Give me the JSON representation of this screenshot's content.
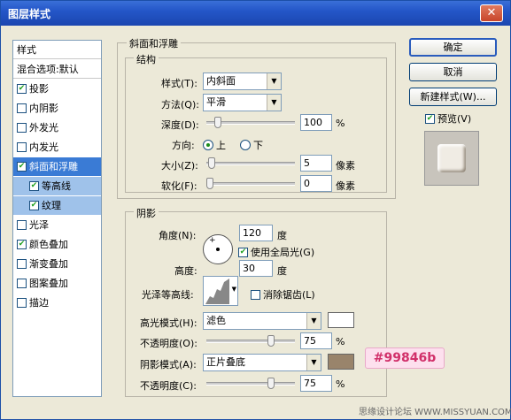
{
  "window": {
    "title": "图层样式",
    "close": "✕"
  },
  "left_panel": {
    "header": "样式",
    "blend_options": "混合选项:默认",
    "items": [
      {
        "label": "投影",
        "checked": true
      },
      {
        "label": "内阴影",
        "checked": false
      },
      {
        "label": "外发光",
        "checked": false
      },
      {
        "label": "内发光",
        "checked": false
      },
      {
        "label": "斜面和浮雕",
        "checked": true
      },
      {
        "label": "等高线",
        "checked": true
      },
      {
        "label": "纹理",
        "checked": true
      },
      {
        "label": "光泽",
        "checked": false
      },
      {
        "label": "颜色叠加",
        "checked": true
      },
      {
        "label": "渐变叠加",
        "checked": false
      },
      {
        "label": "图案叠加",
        "checked": false
      },
      {
        "label": "描边",
        "checked": false
      }
    ]
  },
  "bevel": {
    "section_title": "斜面和浮雕",
    "structure_title": "结构",
    "style_label": "样式(T):",
    "style_value": "内斜面",
    "method_label": "方法(Q):",
    "method_value": "平滑",
    "depth_label": "深度(D):",
    "depth_value": "100",
    "depth_unit": "%",
    "depth_pct": 0.1,
    "direction_label": "方向:",
    "dir_up": "上",
    "dir_down": "下",
    "size_label": "大小(Z):",
    "size_value": "5",
    "size_unit": "像素",
    "size_pct": 0.02,
    "soften_label": "软化(F):",
    "soften_value": "0",
    "soften_unit": "像素",
    "soften_pct": 0.0
  },
  "shading": {
    "title": "阴影",
    "angle_label": "角度(N):",
    "angle_value": "120",
    "angle_unit": "度",
    "global_light": "使用全局光(G)",
    "altitude_label": "高度:",
    "altitude_value": "30",
    "altitude_unit": "度",
    "gloss_label": "光泽等高线:",
    "antialias": "消除锯齿(L)",
    "highlight_mode_label": "高光模式(H):",
    "highlight_mode_value": "滤色",
    "highlight_opacity_label": "不透明度(O):",
    "highlight_opacity_value": "75",
    "highlight_opacity_pct": 0.75,
    "opacity_unit": "%",
    "shadow_mode_label": "阴影模式(A):",
    "shadow_mode_value": "正片叠底",
    "shadow_opacity_label": "不透明度(C):",
    "shadow_opacity_value": "75",
    "shadow_opacity_pct": 0.75,
    "highlight_color": "#ffffff",
    "shadow_color": "#99846b"
  },
  "buttons": {
    "ok": "确定",
    "cancel": "取消",
    "new_style": "新建样式(W)...",
    "preview": "预览(V)"
  },
  "callout": "#99846b",
  "watermark": "思缘设计论坛 WWW.MISSYUAN.COM"
}
